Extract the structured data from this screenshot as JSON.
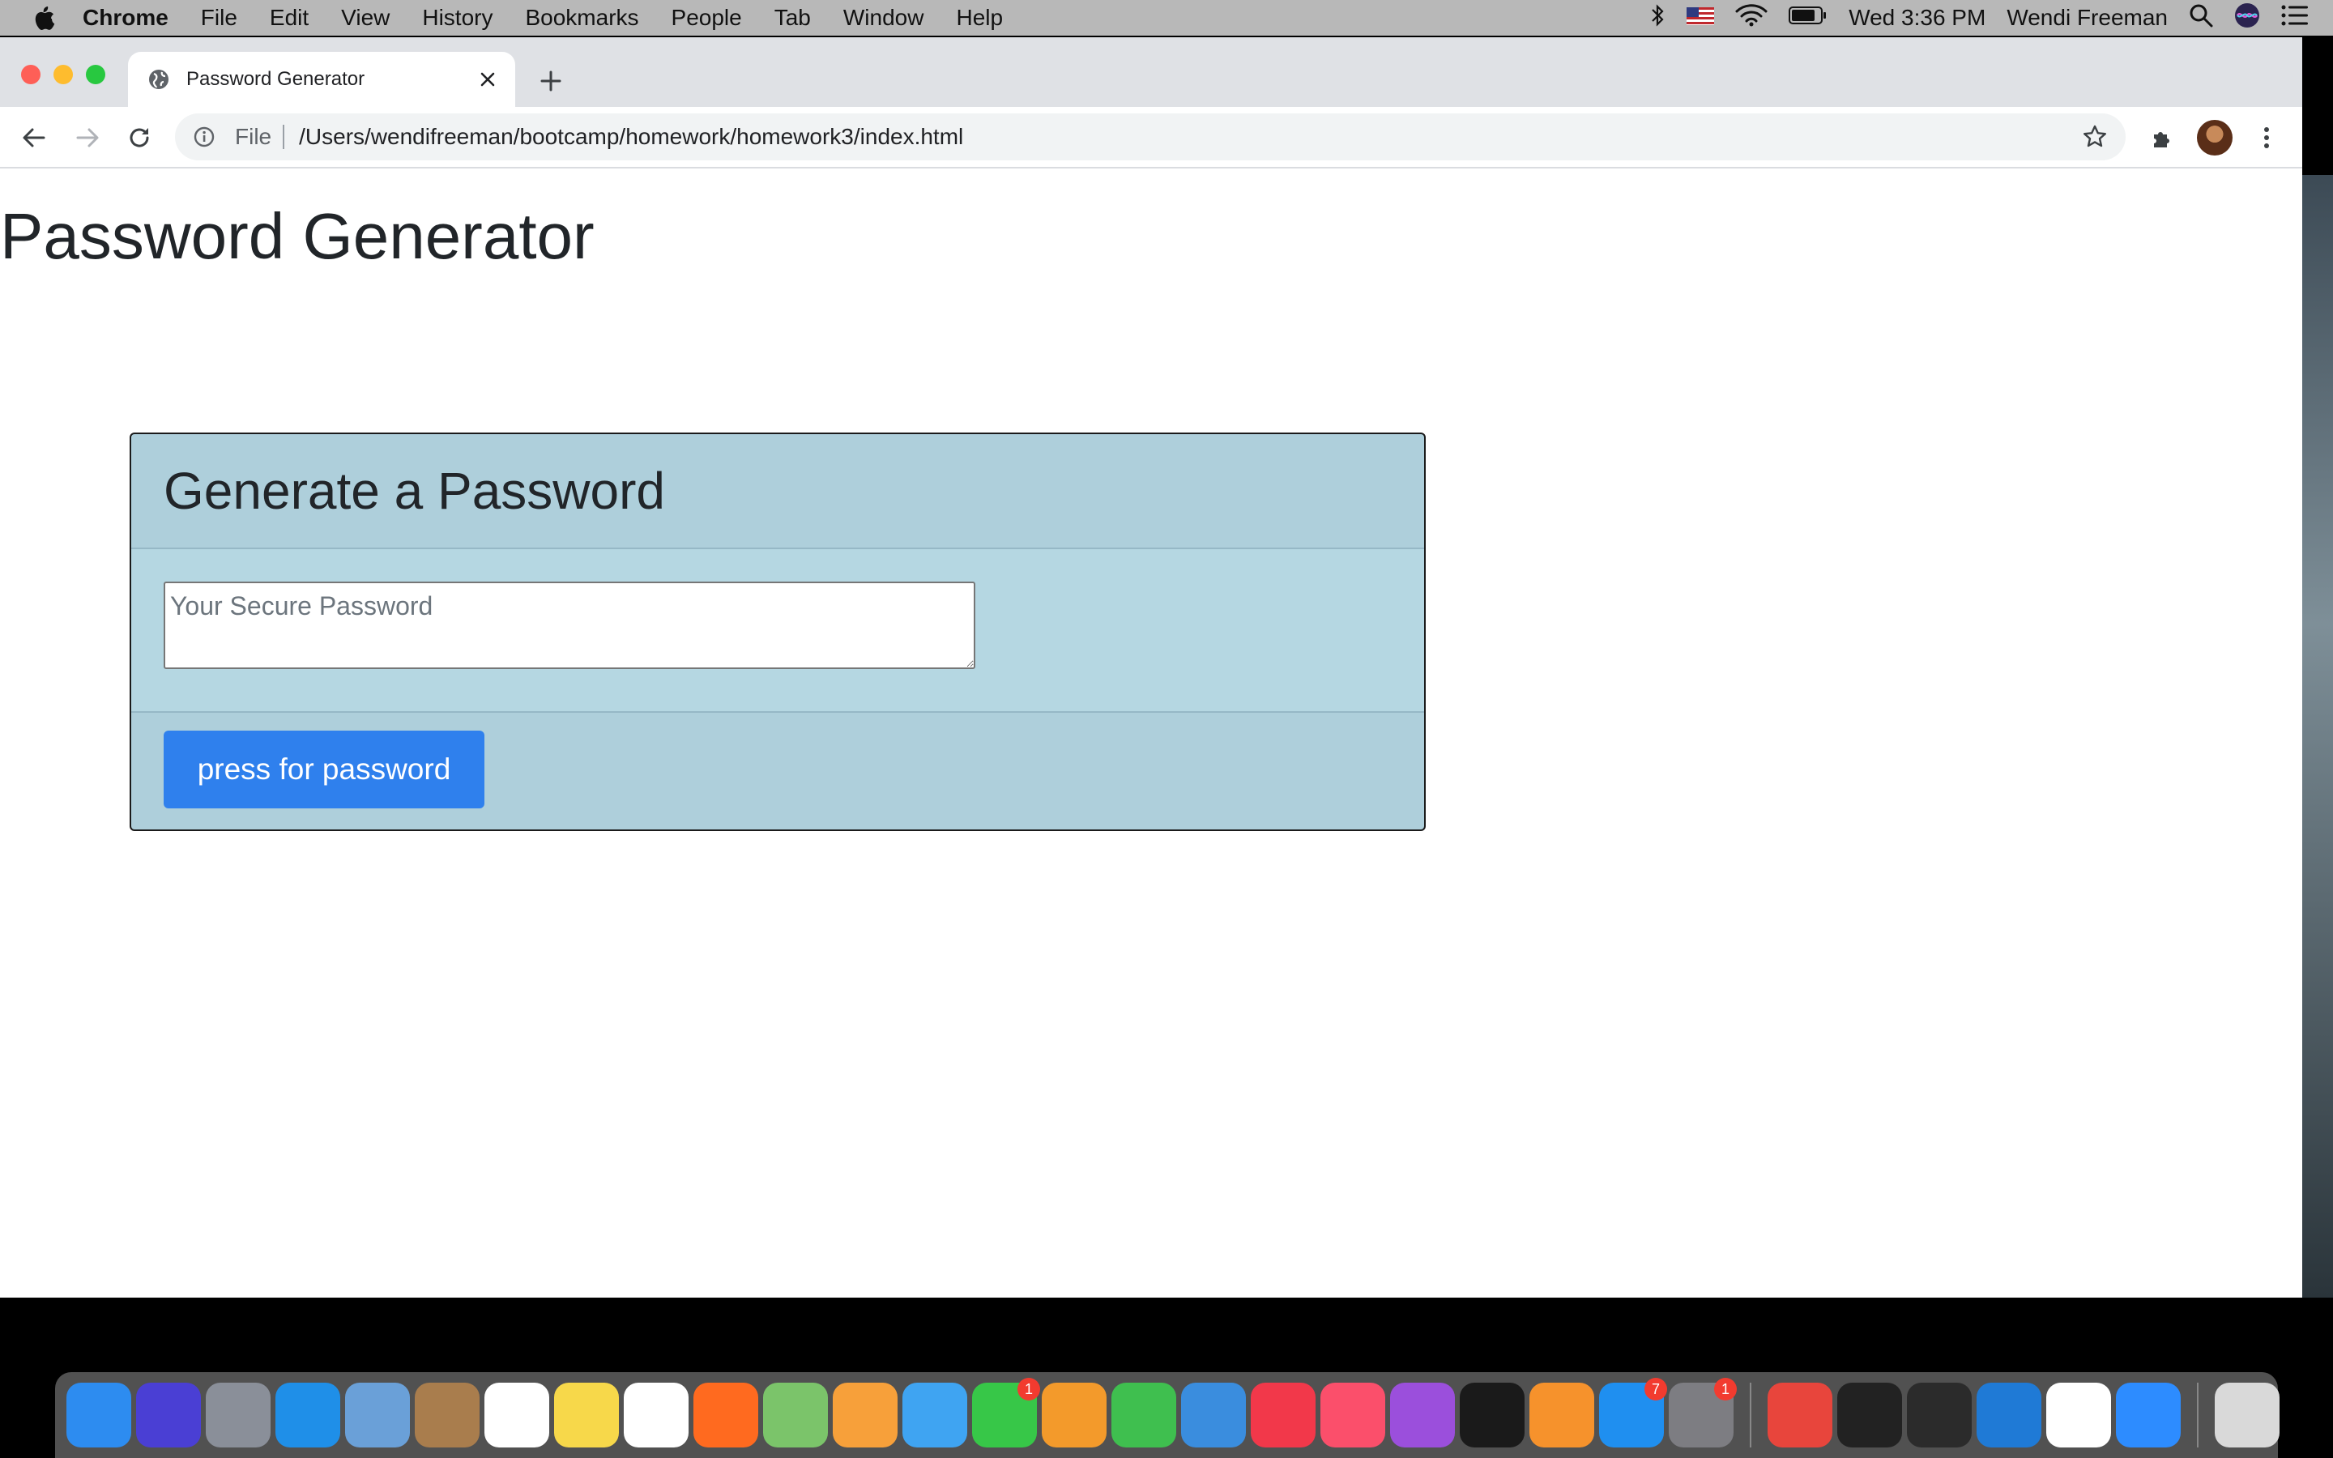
{
  "menubar": {
    "app_name": "Chrome",
    "menus": [
      "File",
      "Edit",
      "View",
      "History",
      "Bookmarks",
      "People",
      "Tab",
      "Window",
      "Help"
    ],
    "clock": "Wed 3:36 PM",
    "user": "Wendi Freeman"
  },
  "browser": {
    "tab_title": "Password Generator",
    "url_scheme": "File",
    "url": "/Users/wendifreeman/bootcamp/homework/homework3/index.html"
  },
  "page": {
    "heading": "Password Generator",
    "card_title": "Generate a Password",
    "password_placeholder": "Your Secure Password",
    "generate_button": "press for password"
  },
  "dock": {
    "apps": [
      {
        "name": "finder",
        "color": "#2d8cf0"
      },
      {
        "name": "siri",
        "color": "#4a3fd4"
      },
      {
        "name": "launchpad",
        "color": "#8a8f99"
      },
      {
        "name": "safari",
        "color": "#1f8fe8"
      },
      {
        "name": "mail-bird",
        "color": "#6aa0d8"
      },
      {
        "name": "contacts",
        "color": "#a97d4d"
      },
      {
        "name": "calendar",
        "color": "#ffffff"
      },
      {
        "name": "notes",
        "color": "#f7d84a"
      },
      {
        "name": "reminders",
        "color": "#ffffff"
      },
      {
        "name": "firefox",
        "color": "#ff6a1f"
      },
      {
        "name": "maps",
        "color": "#7bc46a"
      },
      {
        "name": "photos",
        "color": "#f7a03a"
      },
      {
        "name": "messages",
        "color": "#3fa4f2"
      },
      {
        "name": "facetime",
        "color": "#37c748",
        "badge": "1"
      },
      {
        "name": "pages",
        "color": "#f39a2b"
      },
      {
        "name": "numbers",
        "color": "#3fbf4f"
      },
      {
        "name": "keynote",
        "color": "#3a8dde"
      },
      {
        "name": "news",
        "color": "#f2384a"
      },
      {
        "name": "music",
        "color": "#fb4f6b"
      },
      {
        "name": "podcasts",
        "color": "#9b4fdc"
      },
      {
        "name": "apple-tv",
        "color": "#1a1a1a"
      },
      {
        "name": "books",
        "color": "#f6922c"
      },
      {
        "name": "app-store",
        "color": "#1f8ff0",
        "badge": "7"
      },
      {
        "name": "system-preferences",
        "color": "#7d7d82",
        "badge": "1"
      }
    ],
    "apps_right": [
      {
        "name": "chrome",
        "color": "#e8453c"
      },
      {
        "name": "terminal",
        "color": "#222222"
      },
      {
        "name": "iterm",
        "color": "#2b2b2b"
      },
      {
        "name": "vscode",
        "color": "#1f7ad6"
      },
      {
        "name": "slack",
        "color": "#ffffff"
      },
      {
        "name": "zoom",
        "color": "#2d8cff"
      }
    ],
    "trash": {
      "name": "trash",
      "color": "#d9d9d9"
    }
  }
}
